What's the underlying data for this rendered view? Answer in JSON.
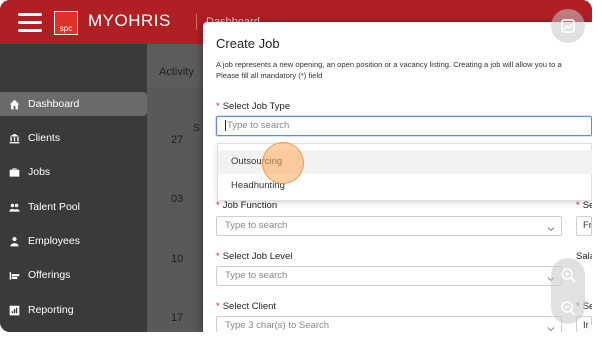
{
  "header": {
    "logo_text": "spc",
    "brand": "MYOHRIS",
    "page_hint": "Dashboard"
  },
  "sidebar": {
    "items": [
      {
        "label": "Dashboard",
        "icon": "home-icon",
        "active": true
      },
      {
        "label": "Clients",
        "icon": "bank-icon",
        "active": false
      },
      {
        "label": "Jobs",
        "icon": "briefcase-icon",
        "active": false
      },
      {
        "label": "Talent Pool",
        "icon": "users-icon",
        "active": false
      },
      {
        "label": "Employees",
        "icon": "user-tie-icon",
        "active": false
      },
      {
        "label": "Offerings",
        "icon": "offerings-icon",
        "active": false
      },
      {
        "label": "Reporting",
        "icon": "report-icon",
        "active": false
      }
    ]
  },
  "content": {
    "activity_label": "Activity",
    "column_letter": "S",
    "dates": [
      "27",
      "03",
      "10",
      "17"
    ]
  },
  "modal": {
    "title": "Create Job",
    "description_line1": "A job represents a new opening, an open position or a vacancy listing. Creating a job will allow you to a",
    "description_line2": "Please fill all mandatory (*) field",
    "job_type": {
      "label": "Select Job Type",
      "placeholder": "Type to search"
    },
    "dropdown_options": [
      "Outsourcing",
      "Headhunting"
    ],
    "job_function": {
      "label": "Job Function",
      "placeholder": "Type to search"
    },
    "job_level": {
      "label": "Select Job Level",
      "placeholder": "Type to search"
    },
    "client": {
      "label": "Select Client",
      "placeholder": "Type 3 char(s) to Search"
    },
    "right_col": {
      "label1": "Se",
      "value1": "Fr",
      "label2": "Sala",
      "label3": "Se",
      "value3": "Ir"
    }
  },
  "overlay": {
    "screenshot_icon": "image-edit-icon",
    "zoom_in_icon": "zoom-in-icon",
    "zoom_out_icon": "zoom-out-icon"
  }
}
